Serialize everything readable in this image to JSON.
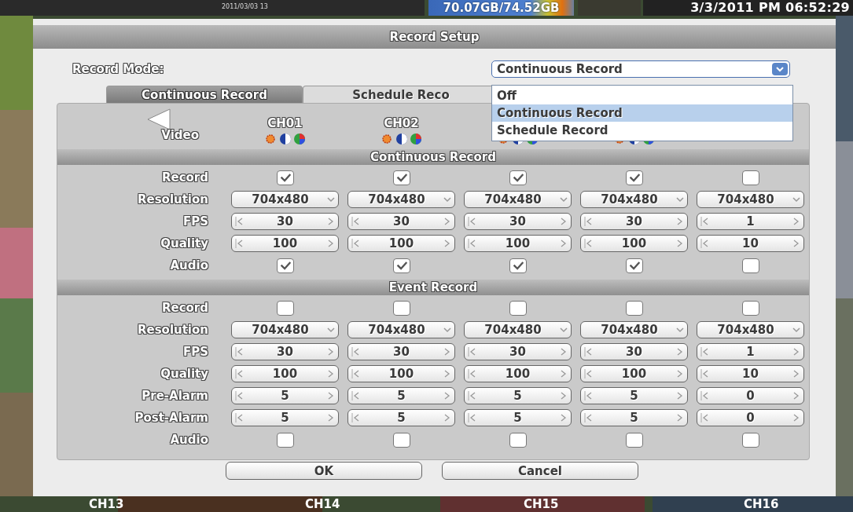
{
  "status_bar": {
    "camera_time": "2011/03/03 13",
    "storage": "70.07GB/74.52GB",
    "datetime": "3/3/2011 PM 06:52:29"
  },
  "dialog": {
    "title": "Record Setup",
    "record_mode": {
      "label": "Record Mode:",
      "value": "Continuous Record",
      "expanded": true,
      "options": [
        {
          "label": "Off",
          "selected": false
        },
        {
          "label": "Continuous Record",
          "selected": true
        },
        {
          "label": "Schedule Record",
          "selected": false
        }
      ]
    },
    "tabs": [
      {
        "label": "Continuous Record",
        "selected": true
      },
      {
        "label": "Schedule Reco",
        "selected": false
      }
    ],
    "channel_headers": [
      "CH01",
      "CH02"
    ],
    "video_label": "Video",
    "sections": [
      {
        "title": "Continuous Record",
        "rows": [
          {
            "kind": "check",
            "label": "Record",
            "cells": [
              {
                "checked": true
              },
              {
                "checked": true
              },
              {
                "checked": true
              },
              {
                "checked": true
              },
              {
                "checked": false
              }
            ]
          },
          {
            "kind": "select",
            "label": "Resolution",
            "cells": [
              {
                "value": "704x480"
              },
              {
                "value": "704x480"
              },
              {
                "value": "704x480"
              },
              {
                "value": "704x480"
              },
              {
                "value": "704x480"
              }
            ]
          },
          {
            "kind": "spin",
            "label": "FPS",
            "cells": [
              {
                "value": "30"
              },
              {
                "value": "30"
              },
              {
                "value": "30"
              },
              {
                "value": "30"
              },
              {
                "value": "1"
              }
            ]
          },
          {
            "kind": "spin",
            "label": "Quality",
            "cells": [
              {
                "value": "100"
              },
              {
                "value": "100"
              },
              {
                "value": "100"
              },
              {
                "value": "100"
              },
              {
                "value": "10"
              }
            ]
          },
          {
            "kind": "check",
            "label": "Audio",
            "cells": [
              {
                "checked": true
              },
              {
                "checked": true
              },
              {
                "checked": true
              },
              {
                "checked": true
              },
              {
                "checked": false
              }
            ]
          }
        ]
      },
      {
        "title": "Event Record",
        "rows": [
          {
            "kind": "check",
            "label": "Record",
            "cells": [
              {
                "checked": false
              },
              {
                "checked": false
              },
              {
                "checked": false
              },
              {
                "checked": false
              },
              {
                "checked": false
              }
            ]
          },
          {
            "kind": "select",
            "label": "Resolution",
            "cells": [
              {
                "value": "704x480"
              },
              {
                "value": "704x480"
              },
              {
                "value": "704x480"
              },
              {
                "value": "704x480"
              },
              {
                "value": "704x480"
              }
            ]
          },
          {
            "kind": "spin",
            "label": "FPS",
            "cells": [
              {
                "value": "30"
              },
              {
                "value": "30"
              },
              {
                "value": "30"
              },
              {
                "value": "30"
              },
              {
                "value": "1"
              }
            ]
          },
          {
            "kind": "spin",
            "label": "Quality",
            "cells": [
              {
                "value": "100"
              },
              {
                "value": "100"
              },
              {
                "value": "100"
              },
              {
                "value": "100"
              },
              {
                "value": "10"
              }
            ]
          },
          {
            "kind": "spin",
            "label": "Pre-Alarm",
            "cells": [
              {
                "value": "5"
              },
              {
                "value": "5"
              },
              {
                "value": "5"
              },
              {
                "value": "5"
              },
              {
                "value": "0"
              }
            ]
          },
          {
            "kind": "spin",
            "label": "Post-Alarm",
            "cells": [
              {
                "value": "5"
              },
              {
                "value": "5"
              },
              {
                "value": "5"
              },
              {
                "value": "5"
              },
              {
                "value": "0"
              }
            ]
          },
          {
            "kind": "check",
            "label": "Audio",
            "cells": [
              {
                "checked": false
              },
              {
                "checked": false
              },
              {
                "checked": false
              },
              {
                "checked": false
              },
              {
                "checked": false
              }
            ]
          }
        ]
      }
    ],
    "buttons": [
      "OK",
      "Cancel"
    ]
  },
  "channel_bar": [
    "CH13",
    "CH14",
    "CH15",
    "CH16"
  ]
}
